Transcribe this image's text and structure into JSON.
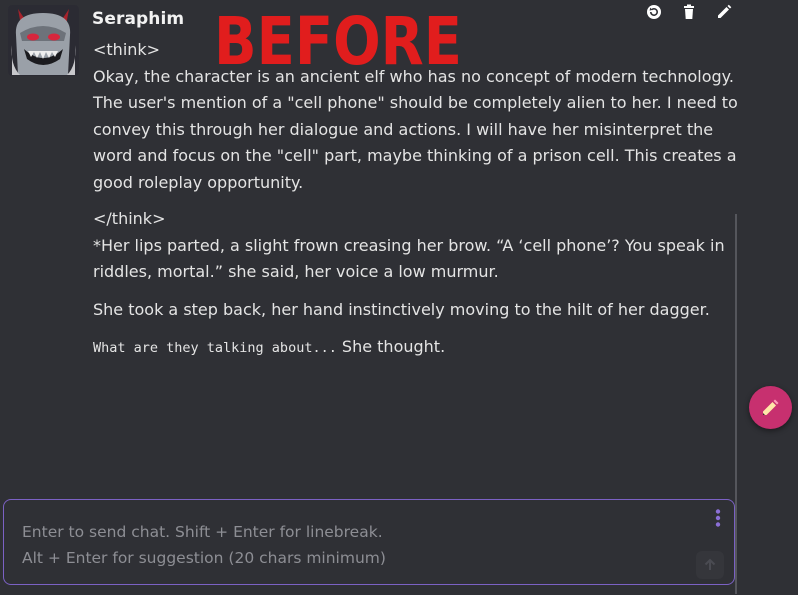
{
  "character": {
    "name": "Seraphim",
    "avatar_icon": "demon-avatar-icon"
  },
  "annotation": {
    "label": "BEFORE",
    "color": "#e11d1d"
  },
  "message_actions": [
    {
      "name": "regenerate-icon"
    },
    {
      "name": "trash-icon"
    },
    {
      "name": "edit-icon"
    }
  ],
  "message": {
    "think_open": "<think>",
    "think_body": "Okay, the character is an ancient elf who has no concept of modern technology. The user's mention of a \"cell phone\" should be completely alien to her. I need to convey this through her dialogue and actions. I will have her misinterpret the word and focus on the \"cell\" part, maybe thinking of a prison cell. This creates a good roleplay opportunity.",
    "think_close": "</think>",
    "paragraph1": "*Her lips parted, a slight frown creasing her brow. “A ‘cell phone’? You speak in riddles, mortal.” she said, her voice a low murmur.",
    "paragraph2": "She took a step back, her hand instinctively moving to the hilt of her dagger.",
    "paragraph3_mono": "What are they talking about...",
    "paragraph3_rest": " She thought."
  },
  "composer": {
    "placeholder": "Enter to send chat. Shift + Enter for linebreak.\nAlt + Enter for suggestion (20 chars minimum)",
    "value": ""
  },
  "colors": {
    "background": "#2f3035",
    "accent_border": "#7b61c4",
    "fab": "#c7306f",
    "kebab": "#8b6fd6"
  }
}
